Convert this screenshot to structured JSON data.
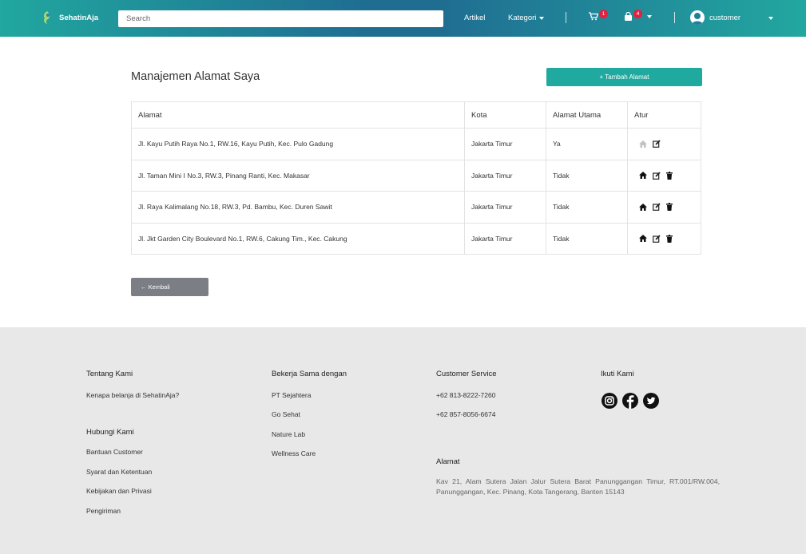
{
  "navbar": {
    "brand": "SehatinAja",
    "search_placeholder": "Search",
    "artikel": "Artikel",
    "kategori": "Kategori",
    "cart_count": "1",
    "orders_count": "4",
    "user": "customer"
  },
  "main": {
    "title": "Manajemen Alamat Saya",
    "add_button": "+ Tambah Alamat",
    "back_button": "← Kembali",
    "table": {
      "headers": [
        "Alamat",
        "Kota",
        "Alamat Utama",
        "Atur"
      ],
      "rows": [
        {
          "alamat": "Jl. Kayu Putih Raya No.1, RW.16, Kayu Putih, Kec. Pulo Gadung",
          "kota": "Jakarta Timur",
          "utama": "Ya"
        },
        {
          "alamat": "Jl. Taman Mini I No.3, RW.3, Pinang Ranti, Kec. Makasar",
          "kota": "Jakarta Timur",
          "utama": "Tidak"
        },
        {
          "alamat": "Jl. Raya Kalimalang No.18, RW.3, Pd. Bambu, Kec. Duren Sawit",
          "kota": "Jakarta Timur",
          "utama": "Tidak"
        },
        {
          "alamat": "Jl. Jkt Garden City Boulevard No.1, RW.6, Cakung Tim., Kec. Cakung",
          "kota": "Jakarta Timur",
          "utama": "Tidak"
        }
      ]
    }
  },
  "footer": {
    "tentang": {
      "heading": "Tentang Kami",
      "items": [
        "Kenapa belanja di SehatinAja?"
      ]
    },
    "hubungi": {
      "heading": "Hubungi Kami",
      "items": [
        "Bantuan Customer",
        "Syarat dan Ketentuan",
        "Kebijakan dan Privasi",
        "Pengiriman"
      ]
    },
    "kerjasama": {
      "heading": "Bekerja Sama dengan",
      "items": [
        "PT Sejahtera",
        "Go Sehat",
        "Nature Lab",
        "Wellness Care"
      ]
    },
    "cs": {
      "heading": "Customer Service",
      "items": [
        "+62 813-8222-7260",
        "+62 857-8056-6674"
      ]
    },
    "ikuti": {
      "heading": "Ikuti Kami"
    },
    "alamat": {
      "heading": "Alamat",
      "text": "Kav 21, Alam Sutera Jalan Jalur Sutera Barat Panunggangan Timur, RT.001/RW.004, Panunggangan, Kec. Pinang, Kota Tangerang, Banten 15143"
    }
  },
  "colors": {
    "accent": "#20a99f",
    "navbar_mid": "#1f6e92",
    "badge": "#e5203f",
    "back_button": "#7b7e84",
    "footer_bg": "#e8e8e8"
  },
  "icons": [
    "brand-logo-icon",
    "cart-icon",
    "bag-icon",
    "avatar-icon",
    "home-icon",
    "edit-icon",
    "trash-icon",
    "instagram-icon",
    "facebook-icon",
    "twitter-icon"
  ]
}
